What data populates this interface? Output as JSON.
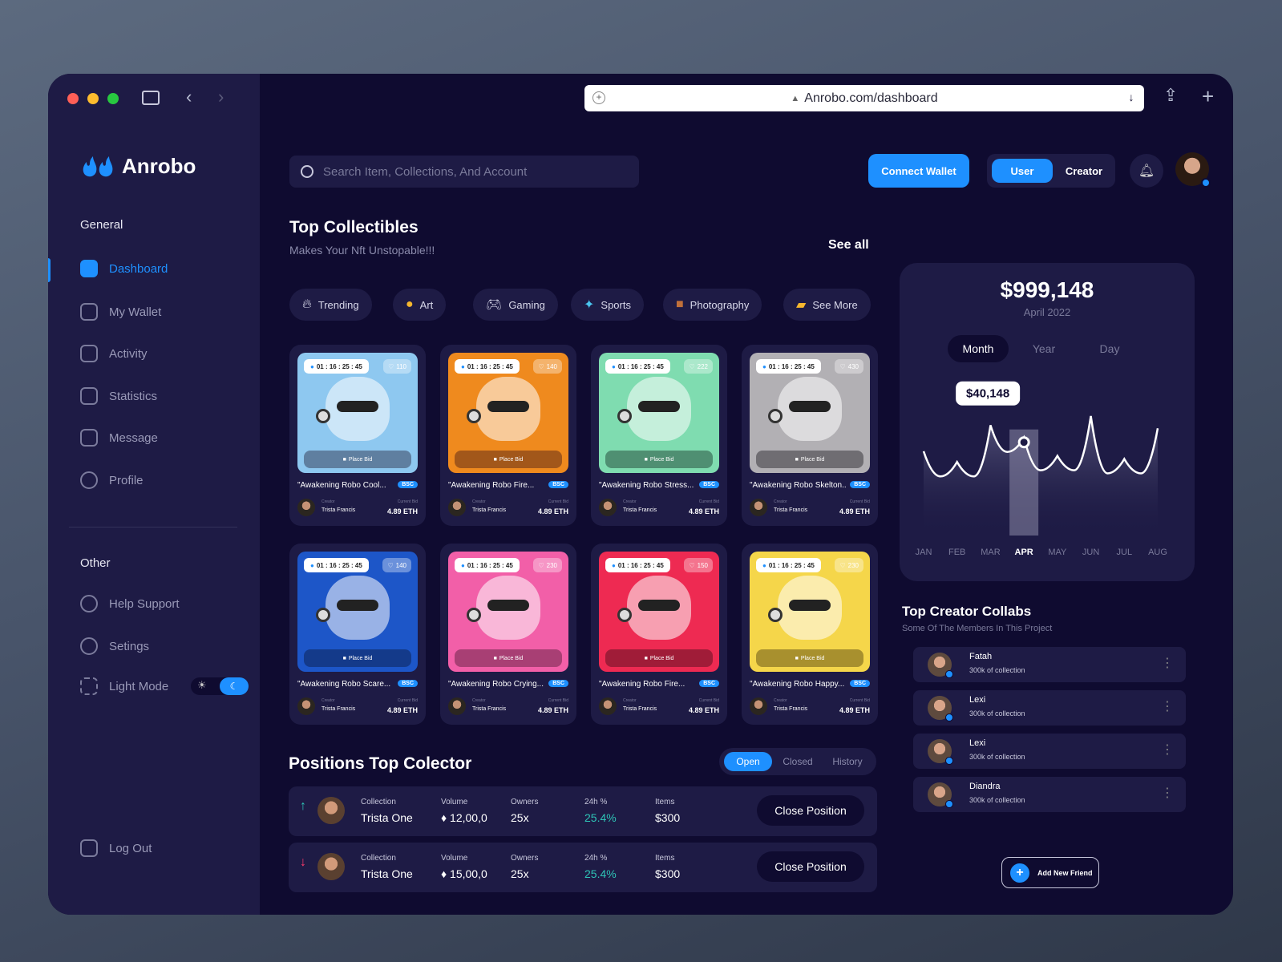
{
  "browser": {
    "url": "Anrobo.com/dashboard"
  },
  "app": {
    "name": "Anrobo"
  },
  "sidebar": {
    "general_title": "General",
    "items": [
      {
        "label": "Dashboard"
      },
      {
        "label": "My Wallet"
      },
      {
        "label": "Activity"
      },
      {
        "label": "Statistics"
      },
      {
        "label": "Message"
      },
      {
        "label": "Profile"
      }
    ],
    "other_title": "Other",
    "other_items": [
      {
        "label": "Help Support"
      },
      {
        "label": "Setings"
      },
      {
        "label": "Light Mode"
      }
    ],
    "logout": "Log Out"
  },
  "header": {
    "search_placeholder": "Search Item, Collections, And Account",
    "connect_wallet": "Connect Wallet",
    "role_user": "User",
    "role_creator": "Creator"
  },
  "collectibles": {
    "title": "Top Collectibles",
    "subtitle": "Makes Your Nft Unstopable!!!",
    "see_all": "See all",
    "categories": [
      {
        "label": "Trending",
        "icon": "fire-icon"
      },
      {
        "label": "Art",
        "icon": "palette-icon"
      },
      {
        "label": "Gaming",
        "icon": "gamepad-icon"
      },
      {
        "label": "Sports",
        "icon": "sports-icon"
      },
      {
        "label": "Photography",
        "icon": "camera-bag-icon"
      },
      {
        "label": "See More",
        "icon": "folder-icon"
      }
    ],
    "cards": [
      {
        "timer": "01 : 16 : 25 : 45",
        "likes": "110",
        "bid_label": "Place Bid",
        "title": "\"Awakening Robo Cool...",
        "tag": "BSC",
        "creator_label": "Creator",
        "creator": "Trista Francis",
        "bid_price_label": "Current Bid",
        "price": "4.89 ETH",
        "bg": "#8ec8f0",
        "bidbg": "#5f7fa0"
      },
      {
        "timer": "01 : 16 : 25 : 45",
        "likes": "140",
        "bid_label": "Place Bid",
        "title": "\"Awakening Robo Fire...",
        "tag": "BSC",
        "creator_label": "Creator",
        "creator": "Trista Francis",
        "bid_price_label": "Current Bid",
        "price": "4.89 ETH",
        "bg": "#ef8a1e",
        "bidbg": "#a2571a"
      },
      {
        "timer": "01 : 16 : 25 : 45",
        "likes": "222",
        "bid_label": "Place Bid",
        "title": "\"Awakening Robo Stress...",
        "tag": "BSC",
        "creator_label": "Creator",
        "creator": "Trista Francis",
        "bid_price_label": "Current Bid",
        "price": "4.89 ETH",
        "bg": "#7fdcb0",
        "bidbg": "#4f8f72"
      },
      {
        "timer": "01 : 16 : 25 : 45",
        "likes": "430",
        "bid_label": "Place Bid",
        "title": "\"Awakening Robo Skelton...",
        "tag": "BSC",
        "creator_label": "Creator",
        "creator": "Trista Francis",
        "bid_price_label": "Current Bid",
        "price": "4.89 ETH",
        "bg": "#b2b0b4",
        "bidbg": "#6f6d72"
      },
      {
        "timer": "01 : 16 : 25 : 45",
        "likes": "140",
        "bid_label": "Place Bid",
        "title": "\"Awakening Robo Scare...",
        "tag": "BSC",
        "creator_label": "Creator",
        "creator": "Trista Francis",
        "bid_price_label": "Current Bid",
        "price": "4.89 ETH",
        "bg": "#1d56c8",
        "bidbg": "#143a8a"
      },
      {
        "timer": "01 : 16 : 25 : 45",
        "likes": "230",
        "bid_label": "Place Bid",
        "title": "\"Awakening Robo Crying...",
        "tag": "BSC",
        "creator_label": "Creator",
        "creator": "Trista Francis",
        "bid_price_label": "Current Bid",
        "price": "4.89 ETH",
        "bg": "#f25fa8",
        "bidbg": "#a83f74"
      },
      {
        "timer": "01 : 16 : 25 : 45",
        "likes": "150",
        "bid_label": "Place Bid",
        "title": "\"Awakening Robo Fire...",
        "tag": "BSC",
        "creator_label": "Creator",
        "creator": "Trista Francis",
        "bid_price_label": "Current Bid",
        "price": "4.89 ETH",
        "bg": "#ee2a52",
        "bidbg": "#a01c38"
      },
      {
        "timer": "01 : 16 : 25 : 45",
        "likes": "230",
        "bid_label": "Place Bid",
        "title": "\"Awakening Robo Happy...",
        "tag": "BSC",
        "creator_label": "Creator",
        "creator": "Trista Francis",
        "bid_price_label": "Current Bid",
        "price": "4.89 ETH",
        "bg": "#f5d64a",
        "bidbg": "#a8902e"
      }
    ]
  },
  "positions": {
    "title": "Positions Top Colector",
    "tabs": [
      "Open",
      "Closed",
      "History"
    ],
    "rows": [
      {
        "direction": "↑",
        "dir_color": "#2ec4b6",
        "collection_label": "Collection",
        "collection": "Trista One",
        "volume_label": "Volume",
        "volume": "12,00,0",
        "owners_label": "Owners",
        "owners": "25x",
        "change_label": "24h %",
        "change": "25.4%",
        "items_label": "Items",
        "items": "$300",
        "action": "Close Position"
      },
      {
        "direction": "↓",
        "dir_color": "#ff3b6b",
        "collection_label": "Collection",
        "collection": "Trista One",
        "volume_label": "Volume",
        "volume": "15,00,0",
        "owners_label": "Owners",
        "owners": "25x",
        "change_label": "24h %",
        "change": "25.4%",
        "items_label": "Items",
        "items": "$300",
        "action": "Close Position"
      }
    ]
  },
  "price_card": {
    "amount": "$999,148",
    "date": "April 2022",
    "periods": [
      "Month",
      "Year",
      "Day"
    ],
    "tooltip": "$40,148"
  },
  "chart_data": {
    "type": "area",
    "categories": [
      "JAN",
      "FEB",
      "MAR",
      "APR",
      "MAY",
      "JUN",
      "JUL",
      "AUG"
    ],
    "highlight": "APR",
    "values": [
      55,
      48,
      72,
      64,
      52,
      78,
      50,
      70
    ],
    "highlight_label": "$40,148"
  },
  "collabs": {
    "title": "Top Creator Collabs",
    "subtitle": "Some Of The Members In This Project",
    "members": [
      {
        "name": "Fatah",
        "sub": "300k of collection"
      },
      {
        "name": "Lexi",
        "sub": "300k of collection"
      },
      {
        "name": "Lexi",
        "sub": "300k of collection"
      },
      {
        "name": "Diandra",
        "sub": "300k of collection"
      }
    ],
    "add_friend": "Add New Friend"
  }
}
